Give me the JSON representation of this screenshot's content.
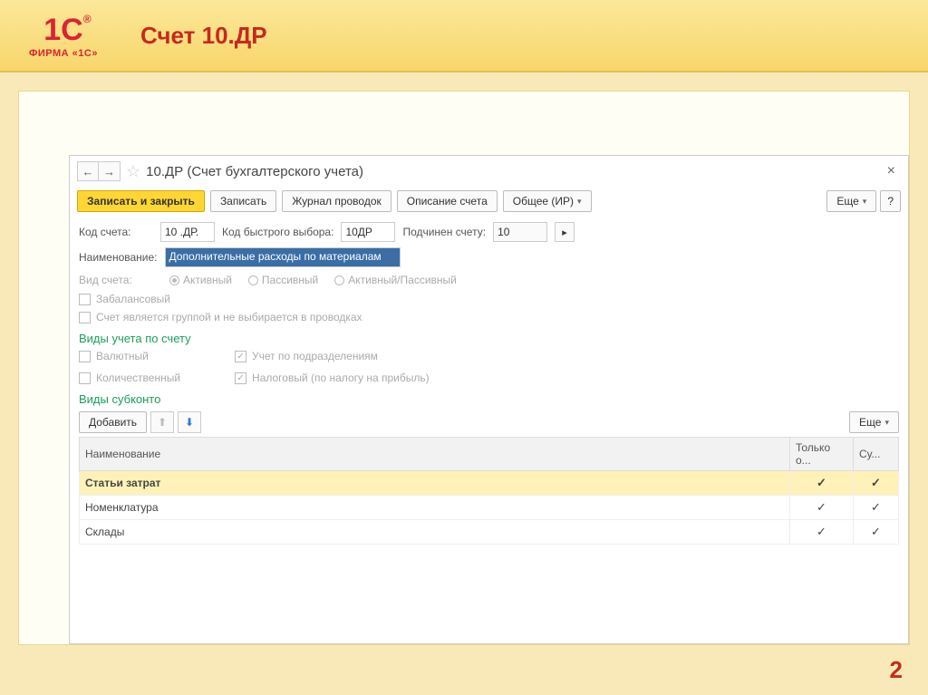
{
  "slide": {
    "logo_text": "1C",
    "logo_sub": "ФИРМА «1С»",
    "title": "Счет 10.ДР",
    "page_number": "2"
  },
  "window": {
    "title": "10.ДР (Счет бухгалтерского учета)"
  },
  "toolbar": {
    "save_close": "Записать и закрыть",
    "save": "Записать",
    "journal": "Журнал проводок",
    "descr": "Описание счета",
    "common": "Общее (ИР)",
    "more": "Еще",
    "help": "?"
  },
  "fields": {
    "code_label": "Код счета:",
    "code_value": "10 .ДР.",
    "quick_label": "Код быстрого выбора:",
    "quick_value": "10ДР",
    "parent_label": "Подчинен счету:",
    "parent_value": "10",
    "name_label": "Наименование:",
    "name_value": "Дополнительные расходы по материалам",
    "type_label": "Вид счета:"
  },
  "radios": {
    "active": "Активный",
    "passive": "Пассивный",
    "both": "Активный/Пассивный"
  },
  "checks": {
    "offbalance": "Забалансовый",
    "group": "Счет является группой и не выбирается в проводках"
  },
  "section_types": "Виды учета по счету",
  "types": {
    "currency": "Валютный",
    "bydept": "Учет по подразделениям",
    "qty": "Количественный",
    "tax": "Налоговый (по налогу на прибыль)"
  },
  "section_sub": "Виды субконто",
  "subtoolbar": {
    "add": "Добавить",
    "more": "Еще"
  },
  "grid": {
    "col_name": "Наименование",
    "col_only": "Только о...",
    "col_sum": "Су...",
    "rows": [
      {
        "name": "Статьи затрат",
        "only": true,
        "sum": true,
        "selected": true
      },
      {
        "name": "Номенклатура",
        "only": true,
        "sum": true,
        "selected": false
      },
      {
        "name": "Склады",
        "only": true,
        "sum": true,
        "selected": false
      }
    ]
  }
}
